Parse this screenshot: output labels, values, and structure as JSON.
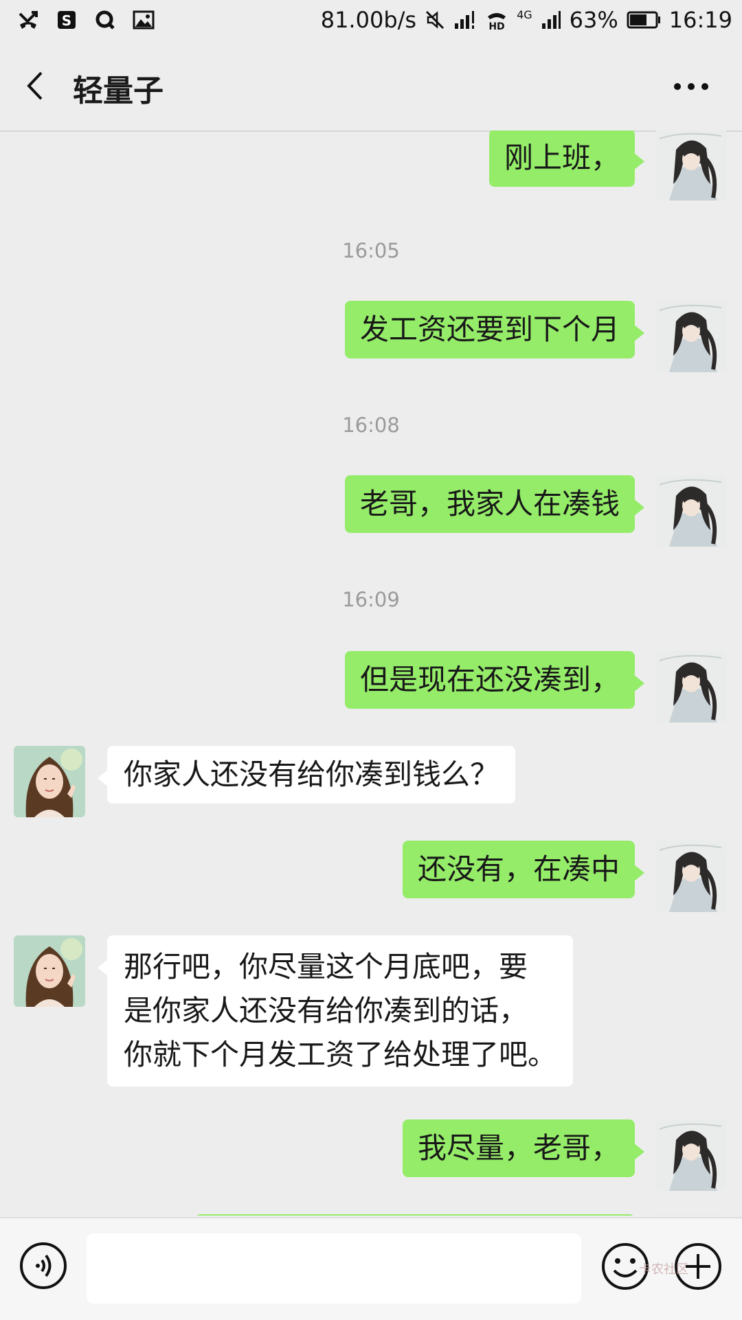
{
  "status_bar": {
    "network_speed": "81.00b/s",
    "network_type": "4G",
    "hd_label": "HD",
    "battery": "63%",
    "time": "16:19",
    "icons": [
      "missed-call-icon",
      "app-s-icon",
      "qq-icon",
      "gallery-icon",
      "mute-icon",
      "signal-icon",
      "hd-call-icon",
      "battery-icon"
    ]
  },
  "header": {
    "title": "轻量子",
    "back_icon": "chevron-left-icon",
    "menu_icon": "more-dots-icon"
  },
  "messages": [
    {
      "type": "msg",
      "side": "right",
      "text": "刚上班，"
    },
    {
      "type": "time",
      "text": "16:05"
    },
    {
      "type": "msg",
      "side": "right",
      "text": "发工资还要到下个月"
    },
    {
      "type": "time",
      "text": "16:08"
    },
    {
      "type": "msg",
      "side": "right",
      "text": "老哥，我家人在凑钱"
    },
    {
      "type": "time",
      "text": "16:09"
    },
    {
      "type": "msg",
      "side": "right",
      "text": "但是现在还没凑到，"
    },
    {
      "type": "msg",
      "side": "left",
      "text": "你家人还没有给你凑到钱么？"
    },
    {
      "type": "msg",
      "side": "right",
      "text": "还没有，在凑中"
    },
    {
      "type": "msg",
      "side": "left",
      "lines": [
        "那行吧，你尽量这个月底吧，要",
        "是你家人还没有给你凑到的话，",
        "你就下个月发工资了给处理了吧。"
      ]
    },
    {
      "type": "msg",
      "side": "right",
      "text": "我尽量，老哥，"
    }
  ],
  "input_bar": {
    "placeholder": "",
    "voice_icon": "voice-icon",
    "emoji_icon": "emoji-icon",
    "plus_icon": "plus-icon",
    "watermark": "卡农社区"
  },
  "colors": {
    "background": "#ededed",
    "sent_bubble": "#95ec69",
    "received_bubble": "#ffffff",
    "timestamp": "#9a9a9a"
  }
}
